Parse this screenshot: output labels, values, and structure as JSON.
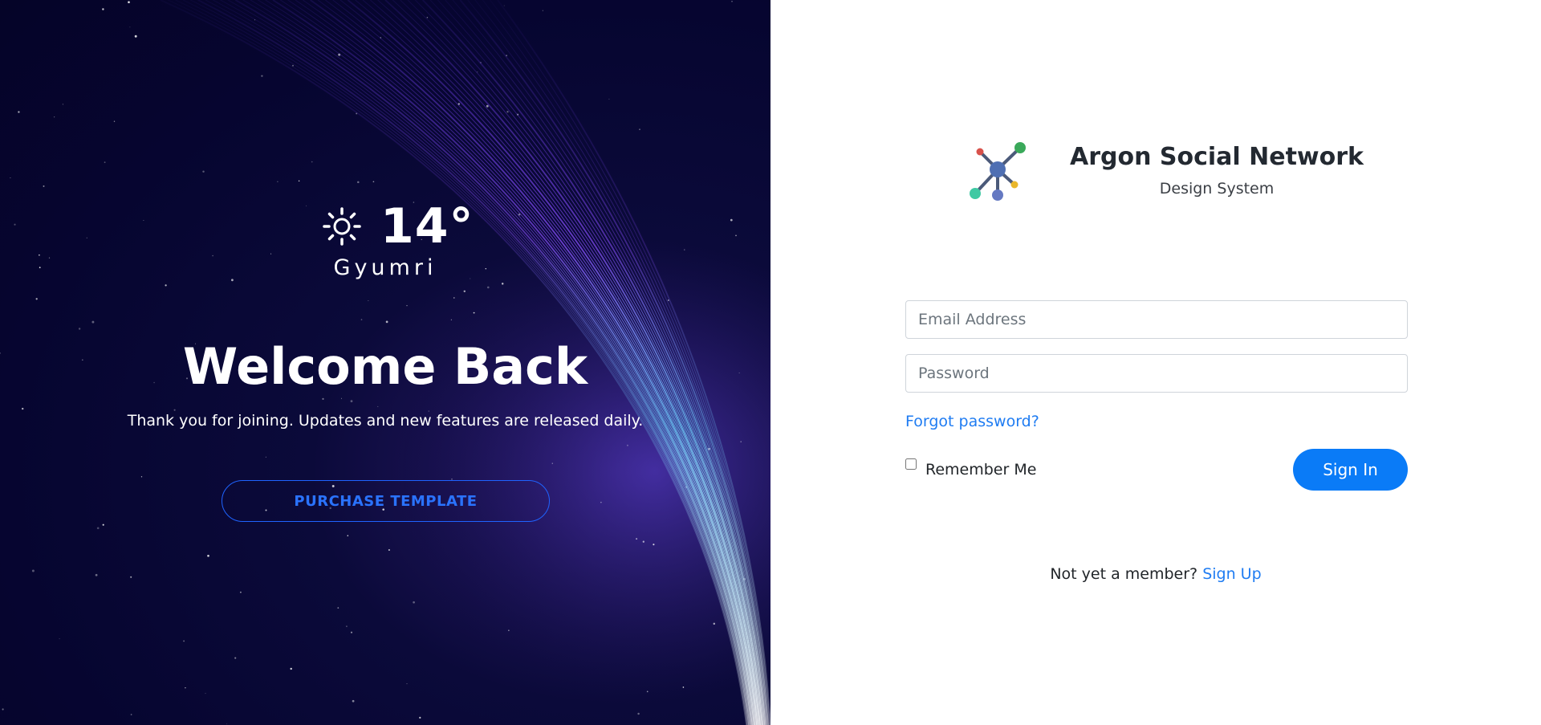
{
  "hero": {
    "weather": {
      "icon": "sun-icon",
      "temperature": "14°",
      "city": "Gyumri"
    },
    "title": "Welcome Back",
    "tagline": "Thank you for joining. Updates and new features are released daily.",
    "purchase_button": "PURCHASE TEMPLATE"
  },
  "login": {
    "brand": {
      "logo_icon": "network-logo-icon",
      "name": "Argon Social Network",
      "subtitle": "Design System"
    },
    "email": {
      "placeholder": "Email Address",
      "value": ""
    },
    "password": {
      "placeholder": "Password",
      "value": ""
    },
    "forgot_link": "Forgot password?",
    "remember_label": "Remember Me",
    "remember_checked": false,
    "signin_button": "Sign In",
    "signup_prompt": "Not yet a member?",
    "signup_link": "Sign Up"
  },
  "colors": {
    "hero_bg": "#060530",
    "accent_blue": "#0a7bf7",
    "link_blue": "#1f7cf2",
    "outline_blue": "#1f63ff"
  }
}
